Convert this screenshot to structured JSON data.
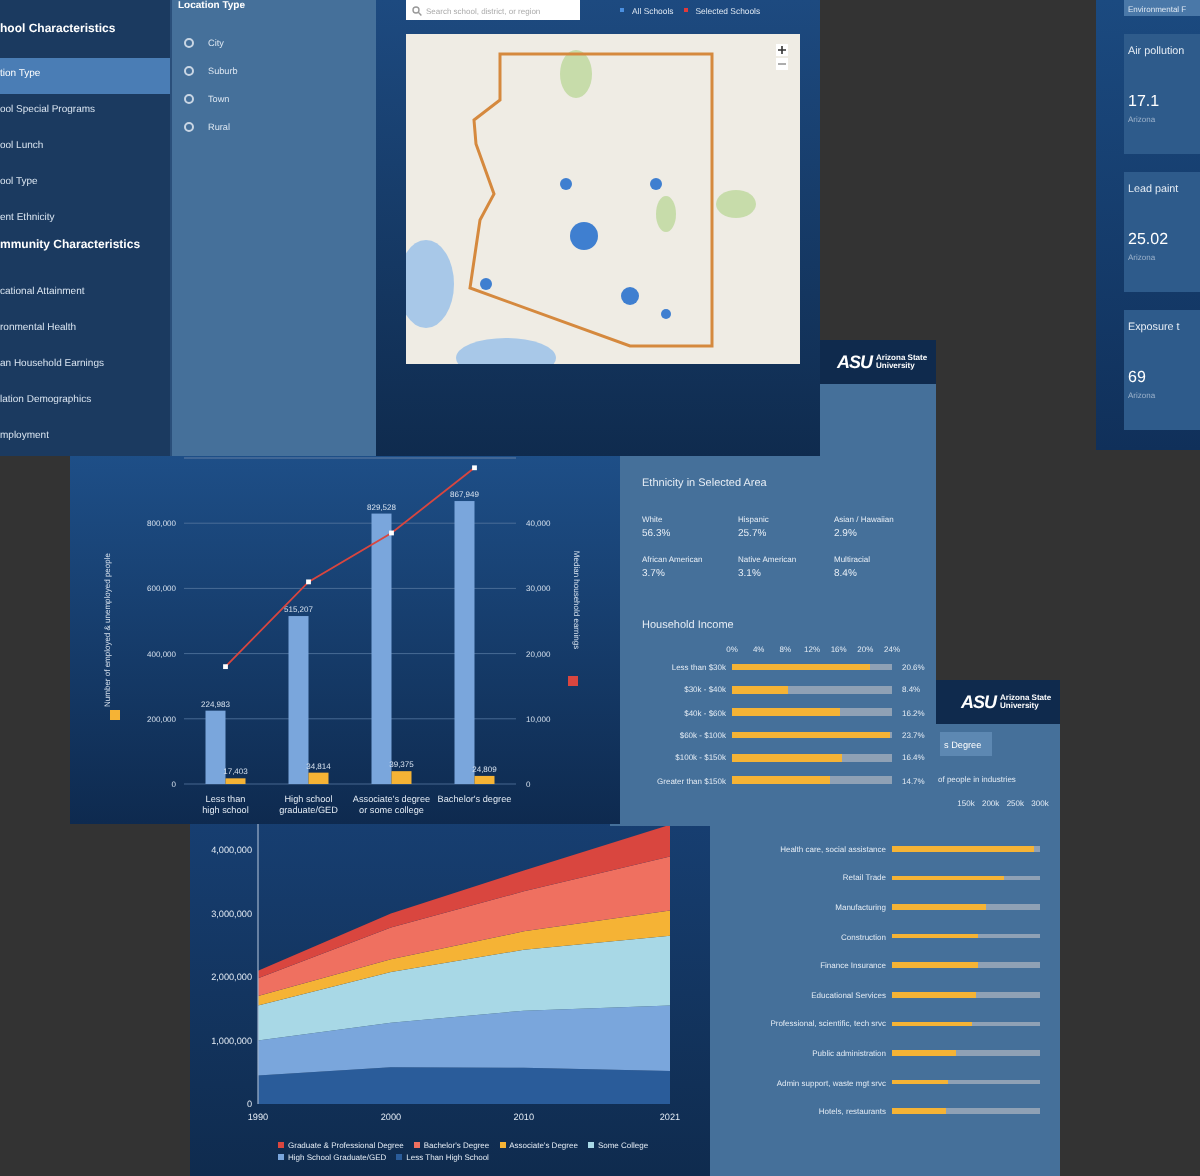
{
  "location_window": {
    "sidebar": [
      {
        "kind": "heading",
        "label": "hool Characteristics"
      },
      {
        "kind": "item",
        "label": "tion Type",
        "selected": true
      },
      {
        "kind": "item",
        "label": "ool Special Programs",
        "selected": false
      },
      {
        "kind": "item",
        "label": "ool Lunch",
        "selected": false
      },
      {
        "kind": "item",
        "label": "ool Type",
        "selected": false
      },
      {
        "kind": "item",
        "label": "ent Ethnicity",
        "selected": false
      },
      {
        "kind": "heading",
        "label": "mmunity Characteristics"
      },
      {
        "kind": "item",
        "label": "cational Attainment",
        "selected": false
      },
      {
        "kind": "item",
        "label": "ronmental Health",
        "selected": false
      },
      {
        "kind": "item",
        "label": "an Household Earnings",
        "selected": false
      },
      {
        "kind": "item",
        "label": "lation Demographics",
        "selected": false
      },
      {
        "kind": "item",
        "label": "mployment",
        "selected": false
      }
    ],
    "filter": {
      "title": "Location Type",
      "options": [
        {
          "label": "City",
          "selected": false
        },
        {
          "label": "Suburb",
          "selected": false
        },
        {
          "label": "Town",
          "selected": false
        },
        {
          "label": "Rural",
          "selected": false
        }
      ]
    },
    "search": {
      "placeholder": "Search school, district, or region"
    },
    "legend": [
      {
        "label": "All Schools",
        "color": "#4a8fe0"
      },
      {
        "label": "Selected Schools",
        "color": "#e03a3a"
      }
    ]
  },
  "environmental_window": {
    "tab": "Environmental F",
    "cards": [
      {
        "title": "Air pollution",
        "value": "17.1",
        "area": "Arizona"
      },
      {
        "title": "Lead paint",
        "value": "25.02",
        "area": "Arizona"
      },
      {
        "title": "Exposure t",
        "value": "69",
        "area": "Arizona"
      }
    ]
  },
  "earnings_window": {
    "chart_data": {
      "type": "bar",
      "categories": [
        "Less than\nhigh school",
        "High school\ngraduate/GED",
        "Associate's degree\nor some college",
        "Bachelor's degree"
      ],
      "ylabel": "Number of employed & unemployed people",
      "ylim": [
        0,
        1000000
      ],
      "grid": true,
      "yticks": [
        {
          "value": 0,
          "label": "0"
        },
        {
          "value": 200000,
          "label": "200,000"
        },
        {
          "value": 400000,
          "label": "400,000"
        },
        {
          "value": 600000,
          "label": "600,000"
        },
        {
          "value": 800000,
          "label": "800,000"
        }
      ],
      "series": [
        {
          "color": "#7aa6dc",
          "values": [
            224983,
            515207,
            829528,
            867949
          ],
          "value_labels": [
            "224,983",
            "515,207",
            "829,528",
            "867,949"
          ]
        },
        {
          "color": "#f5b335",
          "values": [
            17403,
            34814,
            39375,
            24809
          ],
          "value_labels": [
            "17,403",
            "34,814",
            "39,375",
            "24,809"
          ]
        }
      ]
    },
    "line_chart": {
      "chart_data": {
        "type": "line",
        "ylabel": "Median household earnings",
        "ylim": [
          0,
          50000
        ],
        "yticks": [
          {
            "value": 0,
            "label": "0"
          },
          {
            "value": 10000,
            "label": "10,000"
          },
          {
            "value": 20000,
            "label": "20,000"
          },
          {
            "value": 30000,
            "label": "30,000"
          },
          {
            "value": 40000,
            "label": "40,000"
          }
        ],
        "series": [
          {
            "color": "#d9463f",
            "marker": "square",
            "values": [
              18000,
              31000,
              38500,
              48500
            ]
          }
        ]
      }
    }
  },
  "demographics_window": {
    "logo": "ASU",
    "logo_text": "Arizona State University",
    "ethnicity_title": "Ethnicity in Selected Area",
    "ethnicity": [
      {
        "label": "White",
        "value": "56.3%"
      },
      {
        "label": "Hispanic",
        "value": "25.7%"
      },
      {
        "label": "Asian / Hawaiian",
        "value": "2.9%"
      },
      {
        "label": "African American",
        "value": "3.7%"
      },
      {
        "label": "Native American",
        "value": "3.1%"
      },
      {
        "label": "Multiracial",
        "value": "8.4%"
      }
    ],
    "income_chart": {
      "chart_data": {
        "type": "bar",
        "title": "Household Income",
        "orientation": "horizontal",
        "categories": [
          "Less than $30k",
          "$30k - $40k",
          "$40k - $60k",
          "$60k - $100k",
          "$100k - $150k",
          "Greater than $150k"
        ],
        "xlim": [
          0,
          24
        ],
        "xticks": [
          {
            "value": 0,
            "label": "0%"
          },
          {
            "value": 4,
            "label": "4%"
          },
          {
            "value": 8,
            "label": "8%"
          },
          {
            "value": 12,
            "label": "12%"
          },
          {
            "value": 16,
            "label": "16%"
          },
          {
            "value": 20,
            "label": "20%"
          },
          {
            "value": 24,
            "label": "24%"
          }
        ],
        "series": [
          {
            "color": "#f5b335",
            "values": [
              20.6,
              8.4,
              16.2,
              23.7,
              16.4,
              14.7
            ]
          }
        ]
      },
      "share_column": [
        "20.6%",
        "8.4%",
        "16.2%",
        "23.7%",
        "16.4%",
        "14.7%"
      ]
    }
  },
  "education_window": {
    "chart_data": {
      "type": "area",
      "stacked": true,
      "x": [
        1990,
        2000,
        2010,
        2021
      ],
      "xlim": [
        1990,
        2021
      ],
      "ylim": [
        0,
        4600000
      ],
      "yticks": [
        {
          "value": 0,
          "label": "0"
        },
        {
          "value": 1000000,
          "label": "1,000,000"
        },
        {
          "value": 2000000,
          "label": "2,000,000"
        },
        {
          "value": 3000000,
          "label": "3,000,000"
        },
        {
          "value": 4000000,
          "label": "4,000,000"
        }
      ],
      "xticks": [
        1990,
        2000,
        2010,
        2021
      ],
      "series": [
        {
          "name": "Graduate & Professional Degree",
          "color": "#d9463f",
          "values": [
            120000,
            220000,
            330000,
            500000
          ]
        },
        {
          "name": "Bachelor's Degree",
          "color": "#ef7060",
          "values": [
            280000,
            500000,
            630000,
            850000
          ]
        },
        {
          "name": "Associate's Degree",
          "color": "#f5b335",
          "values": [
            150000,
            200000,
            290000,
            400000
          ]
        },
        {
          "name": "Some College",
          "color": "#a8d8e6",
          "values": [
            550000,
            800000,
            960000,
            1100000
          ]
        },
        {
          "name": "High School Graduate/GED",
          "color": "#7aa6dc",
          "values": [
            550000,
            700000,
            900000,
            1030000
          ]
        },
        {
          "name": "Less Than High School",
          "color": "#2a5c9a",
          "values": [
            450000,
            580000,
            570000,
            520000
          ]
        }
      ]
    }
  },
  "industries_window": {
    "logo": "ASU",
    "logo_text": "Arizona State University",
    "button": "s Degree",
    "chart_data": {
      "type": "bar",
      "orientation": "horizontal",
      "title": "of people in industries",
      "categories": [
        "Health care, social assistance",
        "Retail Trade",
        "Manufacturing",
        "Construction",
        "Finance Insurance",
        "Educational Services",
        "Professional, scientific, tech srvc",
        "Public administration",
        "Admin support, waste mgt srvc",
        "Hotels, restaurants"
      ],
      "xlim": [
        0,
        300
      ],
      "xticks": [
        {
          "value": 150,
          "label": "150k"
        },
        {
          "value": 200,
          "label": "200k"
        },
        {
          "value": 250,
          "label": "250k"
        },
        {
          "value": 300,
          "label": "300k"
        }
      ],
      "series": [
        {
          "color": "#f5b335",
          "values": [
            286,
            227,
            190,
            176,
            173,
            169,
            162,
            131,
            115,
            108
          ]
        }
      ]
    }
  }
}
